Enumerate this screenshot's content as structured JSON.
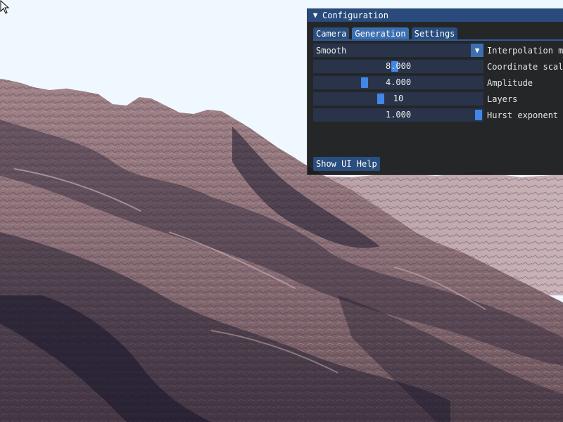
{
  "window": {
    "title": "Configuration",
    "collapse_icon": "triangle-down-icon"
  },
  "tabs": [
    {
      "label": "Camera",
      "active": false
    },
    {
      "label": "Generation",
      "active": true
    },
    {
      "label": "Settings",
      "active": false
    }
  ],
  "controls": {
    "interpolation": {
      "value": "Smooth",
      "label": "Interpolation method"
    },
    "coordinate_scaling": {
      "value": "8.000",
      "label": "Coordinate scaling",
      "fraction": 0.48
    },
    "amplitude": {
      "value": "4.000",
      "label": "Amplitude",
      "fraction": 0.29
    },
    "layers": {
      "value": "10",
      "label": "Layers",
      "fraction": 0.39
    },
    "hurst_exponent": {
      "value": "1.000",
      "label": "Hurst exponent",
      "fraction": 1.0
    }
  },
  "help_button": {
    "label": "Show UI Help"
  },
  "colors": {
    "sky": "#f0f8ff",
    "terrain_light": "#b89a9e",
    "terrain_dark": "#1a1f33",
    "accent": "#4287e6"
  }
}
